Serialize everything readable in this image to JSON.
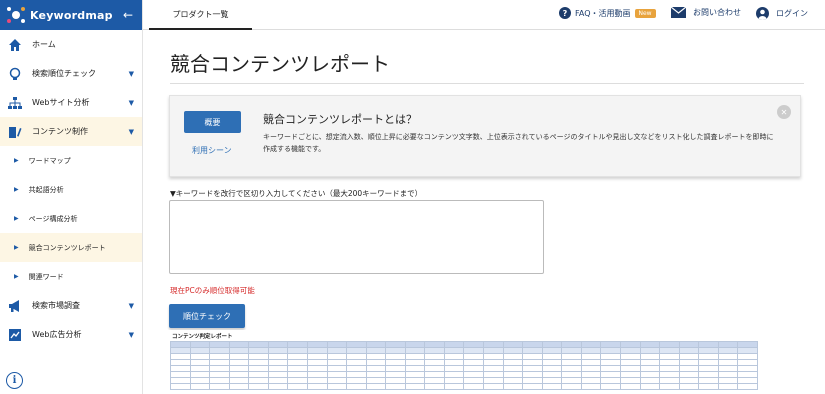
{
  "app": {
    "logo_text": "Keywordmap"
  },
  "sidebar": {
    "items": [
      {
        "label": "ホーム",
        "icon": "home-icon"
      },
      {
        "label": "検索順位チェック",
        "icon": "lightbulb-icon"
      },
      {
        "label": "Webサイト分析",
        "icon": "sitemap-icon"
      },
      {
        "label": "コンテンツ制作",
        "icon": "content-icon"
      }
    ],
    "sub_items": [
      {
        "label": "ワードマップ"
      },
      {
        "label": "共起語分析"
      },
      {
        "label": "ページ構成分析"
      },
      {
        "label": "競合コンテンツレポート"
      },
      {
        "label": "関連ワード"
      }
    ],
    "bottom_items": [
      {
        "label": "検索市場調査",
        "icon": "megaphone-icon"
      },
      {
        "label": "Web広告分析",
        "icon": "chart-icon"
      }
    ]
  },
  "header": {
    "tab_label": "プロダクト一覧",
    "faq_label": "FAQ・活用動画",
    "faq_badge": "New",
    "contact_label": "お問い合わせ",
    "login_label": "ログイン"
  },
  "page": {
    "title": "競合コンテンツレポート",
    "info": {
      "tab_active": "概要",
      "tab_other": "利用シーン",
      "heading": "競合コンテンツレポートとは？",
      "description": "キーワードごとに、想定流入数、順位上昇に必要なコンテンツ文字数、上位表示されているページのタイトルや見出し文などをリスト化した調査レポートを即時に作成する機能です。"
    },
    "keyword_label": "▼キーワードを改行で区切り入力してください（最大200キーワードまで）",
    "keyword_value": "",
    "notice": "現在PCのみ順位取得可能",
    "submit_label": "順位チェック",
    "preview_title": "コンテンツ判定レポート"
  },
  "colors": {
    "brand": "#1d5aa6",
    "accent_button": "#2e6fb5",
    "active_bg": "#fdf6e4",
    "notice": "#d62b2b",
    "badge": "#e8a33d"
  }
}
